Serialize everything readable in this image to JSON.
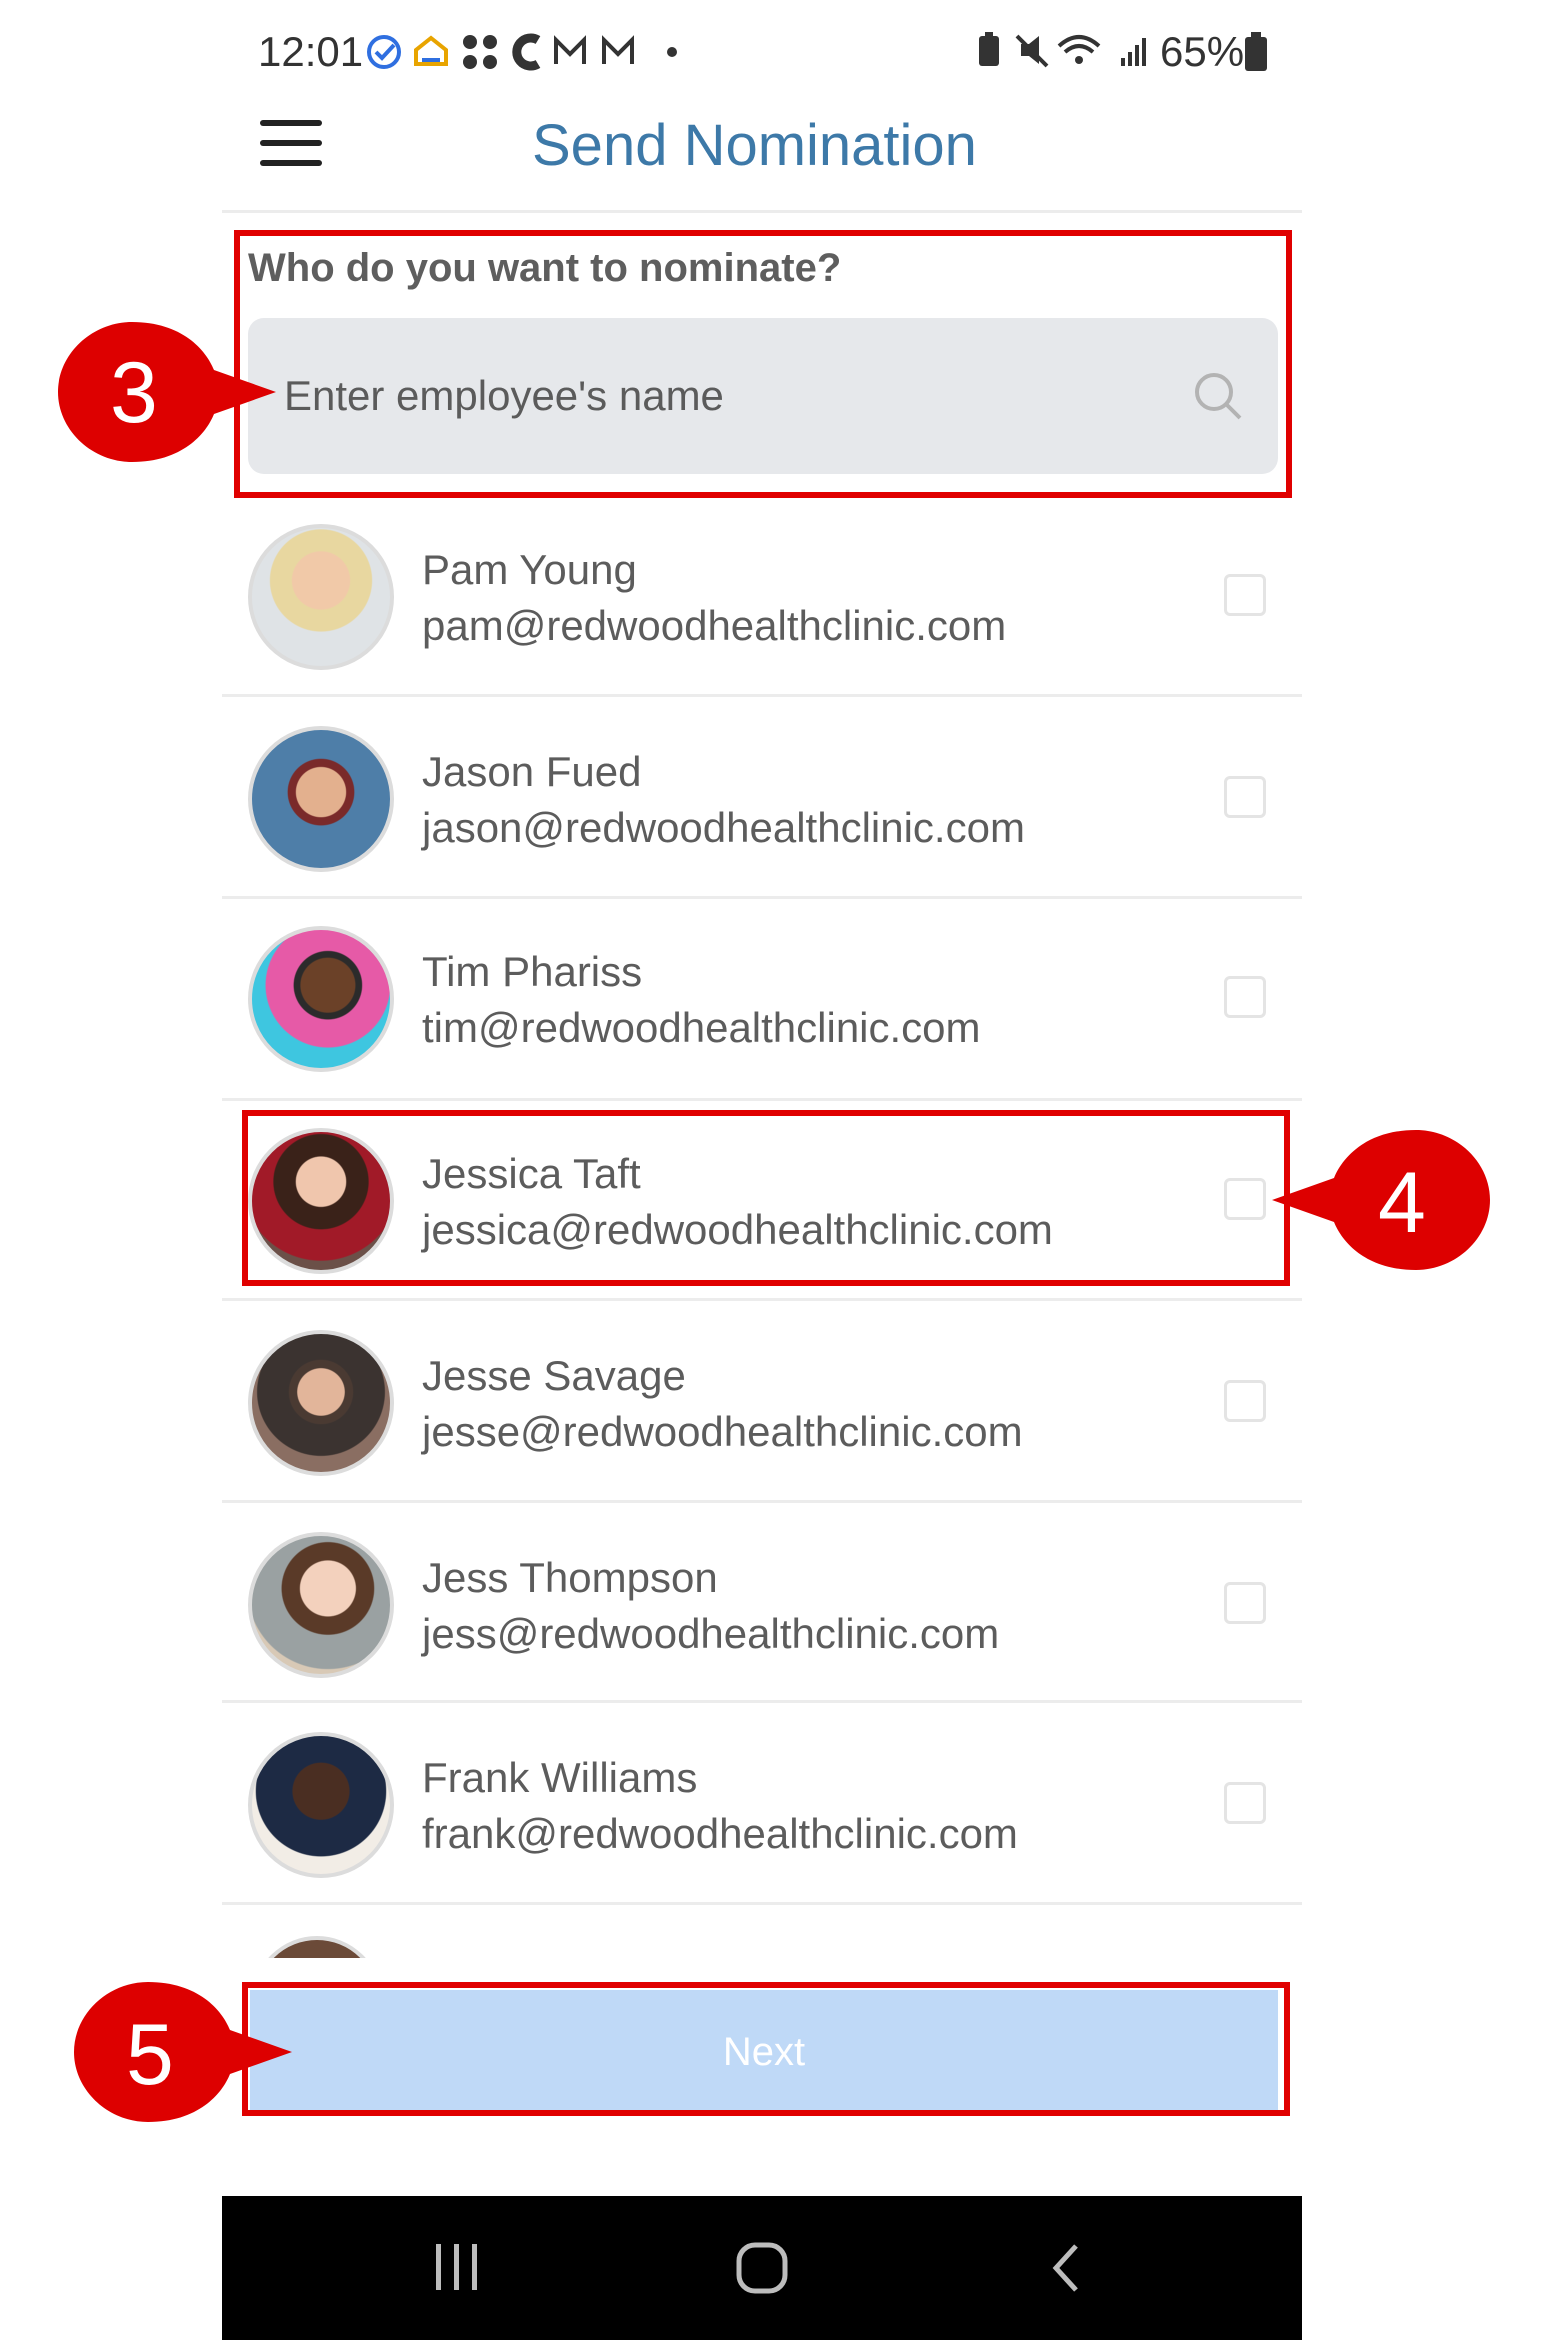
{
  "status_bar": {
    "time": "12:01",
    "battery": "65%",
    "left_icons": [
      "check-circle-icon",
      "home-icon",
      "dots-icon",
      "c-icon",
      "gmail-icon",
      "gmail-icon",
      "dot-icon"
    ],
    "right_icons": [
      "battery-saver-icon",
      "mute-icon",
      "wifi-icon",
      "signal-icon",
      "battery-icon"
    ]
  },
  "header": {
    "title": "Send Nomination",
    "menu_icon": "hamburger-menu-icon"
  },
  "nominate": {
    "question": "Who do you want to nominate?",
    "search_placeholder": "Enter employee's name",
    "search_icon": "search-icon"
  },
  "employees": [
    {
      "name": "Pam Young",
      "email": "pam@redwoodhealthclinic.com",
      "checked": false
    },
    {
      "name": "Jason Fued",
      "email": "jason@redwoodhealthclinic.com",
      "checked": false
    },
    {
      "name": "Tim Phariss",
      "email": "tim@redwoodhealthclinic.com",
      "checked": false
    },
    {
      "name": "Jessica Taft",
      "email": "jessica@redwoodhealthclinic.com",
      "checked": false
    },
    {
      "name": "Jesse Savage",
      "email": "jesse@redwoodhealthclinic.com",
      "checked": false
    },
    {
      "name": "Jess Thompson",
      "email": "jess@redwoodhealthclinic.com",
      "checked": false
    },
    {
      "name": "Frank Williams",
      "email": "frank@redwoodhealthclinic.com",
      "checked": false
    }
  ],
  "footer": {
    "next_label": "Next"
  },
  "callouts": {
    "step3": "3",
    "step4": "4",
    "step5": "5"
  },
  "colors": {
    "title": "#3d79a8",
    "search_bg": "#e6e8eb",
    "next_bg": "#bfd9f7",
    "highlight": "#e00000",
    "callout": "#dd0000"
  },
  "nav_bar": {
    "icons": [
      "recent-apps-icon",
      "home-button-icon",
      "back-icon"
    ]
  }
}
